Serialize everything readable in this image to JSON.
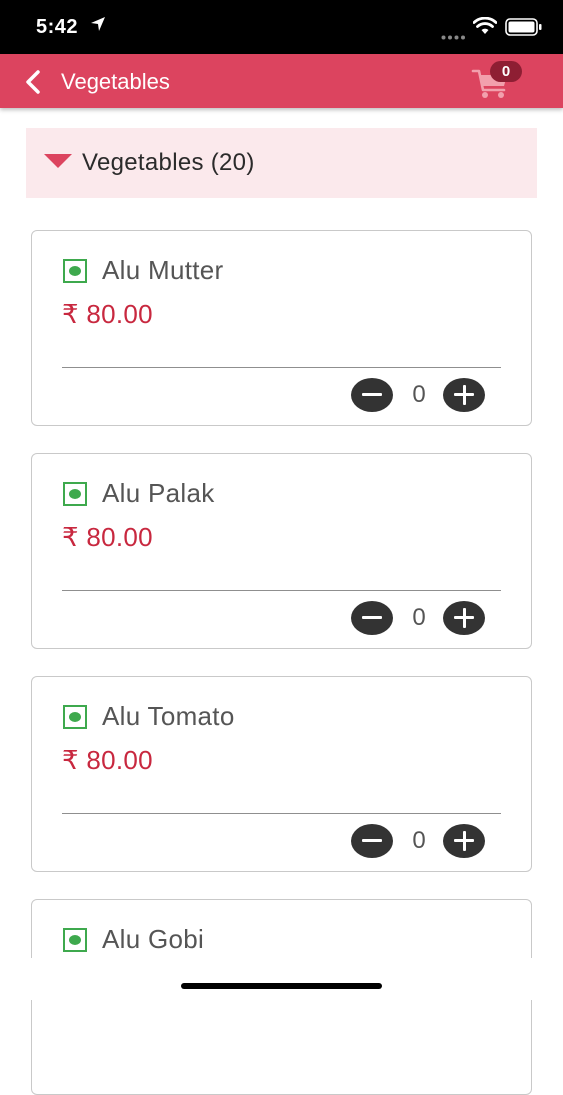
{
  "status_bar": {
    "time": "5:42",
    "icons": [
      "location-arrow-icon",
      "signal-dots-icon",
      "wifi-icon",
      "battery-icon"
    ]
  },
  "app_bar": {
    "title": "Vegetables",
    "back_icon": "chevron-left-icon",
    "cart_icon": "shopping-cart-icon",
    "cart_count": "0",
    "background_color": "#dc445f"
  },
  "category": {
    "title": "Vegetables (20)",
    "expanded": true,
    "background_color": "#fbe9ec"
  },
  "items": [
    {
      "name": "Alu Mutter",
      "price": "₹ 80.00",
      "quantity": "0"
    },
    {
      "name": "Alu Palak",
      "price": "₹ 80.00",
      "quantity": "0"
    },
    {
      "name": "Alu Tomato",
      "price": "₹ 80.00",
      "quantity": "0"
    },
    {
      "name": "Alu Gobi"
    }
  ],
  "colors": {
    "price": "#c8283f",
    "veg_indicator": "#3ea94d",
    "qty_button": "#333333"
  }
}
